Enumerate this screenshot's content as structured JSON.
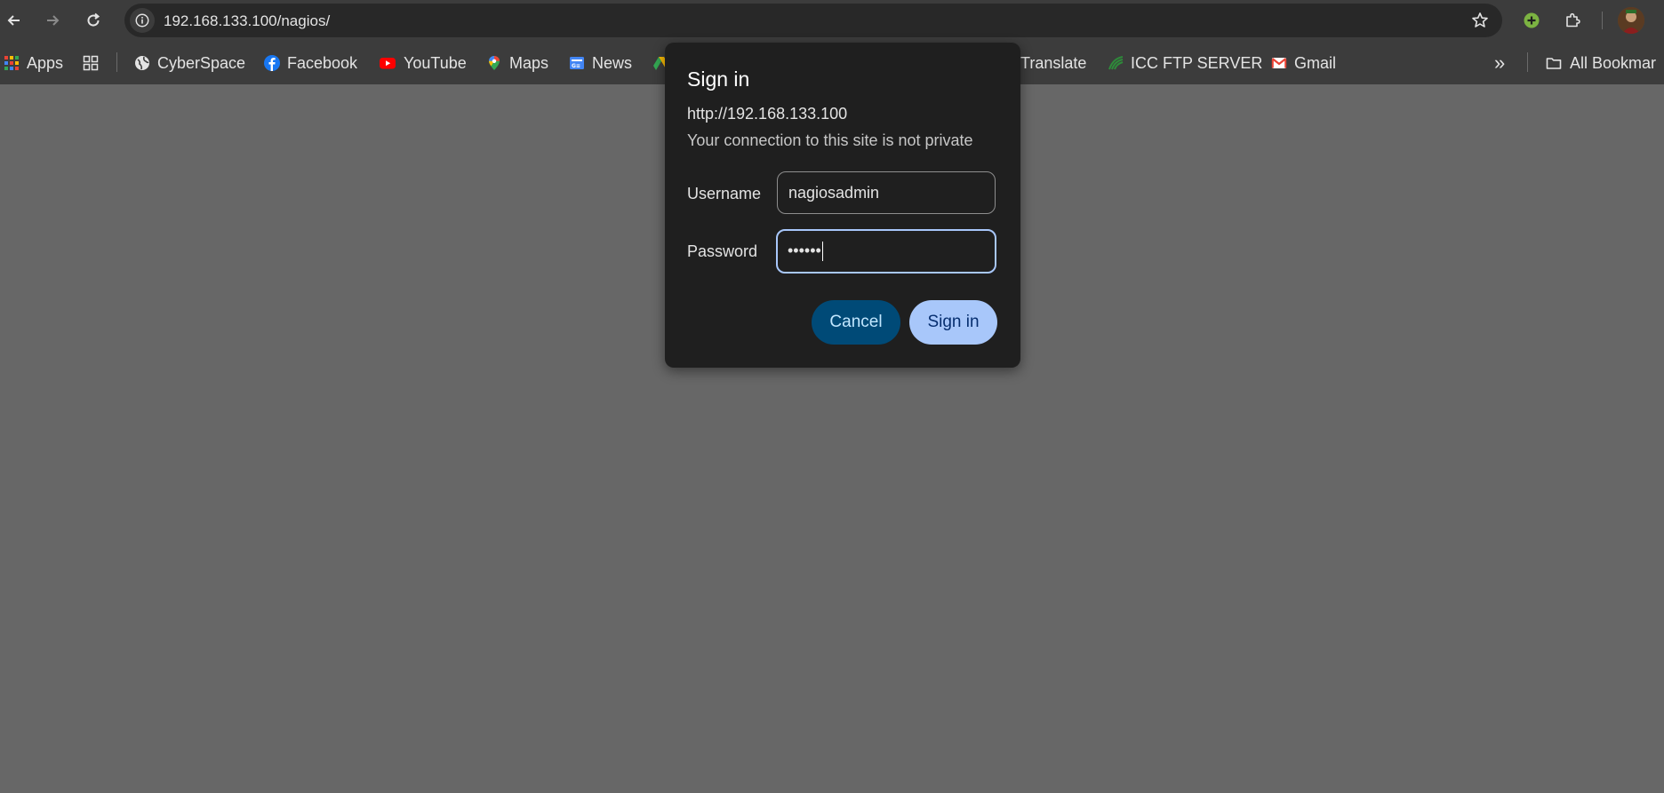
{
  "browser": {
    "url": "192.168.133.100/nagios/",
    "nav": {
      "back_icon": "arrow-left-icon",
      "forward_icon": "arrow-right-icon",
      "reload_icon": "reload-icon"
    }
  },
  "bookmarks": {
    "items": [
      {
        "label": "Apps",
        "icon": "apps-grid-icon"
      },
      {
        "label": "",
        "icon": "tab-groups-icon"
      },
      {
        "label": "CyberSpace",
        "icon": "globe-icon"
      },
      {
        "label": "Facebook",
        "icon": "facebook-icon"
      },
      {
        "label": "YouTube",
        "icon": "youtube-icon"
      },
      {
        "label": "Maps",
        "icon": "maps-pin-icon"
      },
      {
        "label": "News",
        "icon": "news-icon"
      },
      {
        "label": "Translate",
        "icon": ""
      },
      {
        "label": "ICC FTP SERVER",
        "icon": "icc-icon"
      },
      {
        "label": "Gmail",
        "icon": "gmail-icon"
      }
    ],
    "overflow_label": "»",
    "all_bookmarks_label": "All Bookmar"
  },
  "dialog": {
    "title": "Sign in",
    "origin": "http://192.168.133.100",
    "warning": "Your connection to this site is not private",
    "username_label": "Username",
    "username_value": "nagiosadmin",
    "password_label": "Password",
    "password_value": "••••••",
    "cancel_label": "Cancel",
    "signin_label": "Sign in"
  },
  "colors": {
    "page_bg": "#676767",
    "chrome_bg": "#3c3c3c",
    "dialog_bg": "#1f1f1f",
    "primary_button": "#a8c7fa",
    "tonal_button": "#004a77"
  }
}
